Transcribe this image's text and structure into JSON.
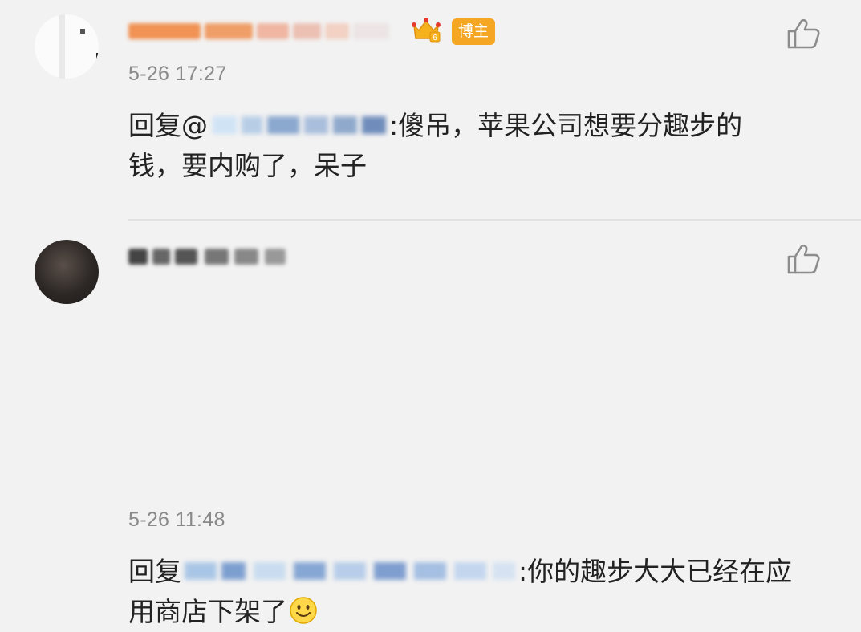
{
  "comments": [
    {
      "name_hidden": "趣步-GH",
      "badge": "博主",
      "crown_level": "6",
      "timestamp": "5-26 17:27",
      "reply_prefix": "回复@",
      "text_line1": ":傻吊，苹果公司想要分趣步的",
      "text_line2": "钱，要内购了，呆子"
    },
    {
      "timestamp": "5-26 11:48",
      "reply_prefix": "回复",
      "text_line1": ":你的趣步大大已经在应",
      "text_line2": "用商店下架了"
    }
  ],
  "icons": {
    "like": "thumbs-up-icon",
    "crown": "crown-icon",
    "emoji": "smiley-icon"
  },
  "colors": {
    "background": "#f2f2f2",
    "name_orange": "#f07a2c",
    "badge": "#f5a623",
    "timestamp": "#8a8a8a",
    "text": "#222222"
  }
}
